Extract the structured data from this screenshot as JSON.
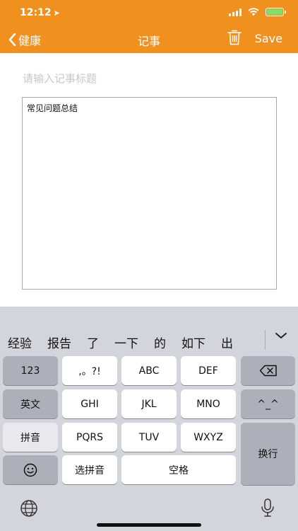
{
  "status": {
    "time": "12:12"
  },
  "nav": {
    "back_label": "健康",
    "title": "记事",
    "save_label": "Save"
  },
  "editor": {
    "title_placeholder": "请输入记事标题",
    "body_text": "常见问题总结"
  },
  "keyboard": {
    "candidates": [
      "经验",
      "报告",
      "了",
      "一下",
      "的",
      "如下",
      "出"
    ],
    "keys": {
      "numbers": "123",
      "punct": ",。?!",
      "abc": "ABC",
      "def": "DEF",
      "english": "英文",
      "ghi": "GHI",
      "jkl": "JKL",
      "mno": "MNO",
      "emoticon": "^_^",
      "pinyin": "拼音",
      "pqrs": "PQRS",
      "tuv": "TUV",
      "wxyz": "WXYZ",
      "enter": "换行",
      "select_pinyin": "选拼音",
      "space": "空格"
    }
  },
  "colors": {
    "accent": "#f0901e",
    "keyboard_bg": "#d3d5dc"
  }
}
